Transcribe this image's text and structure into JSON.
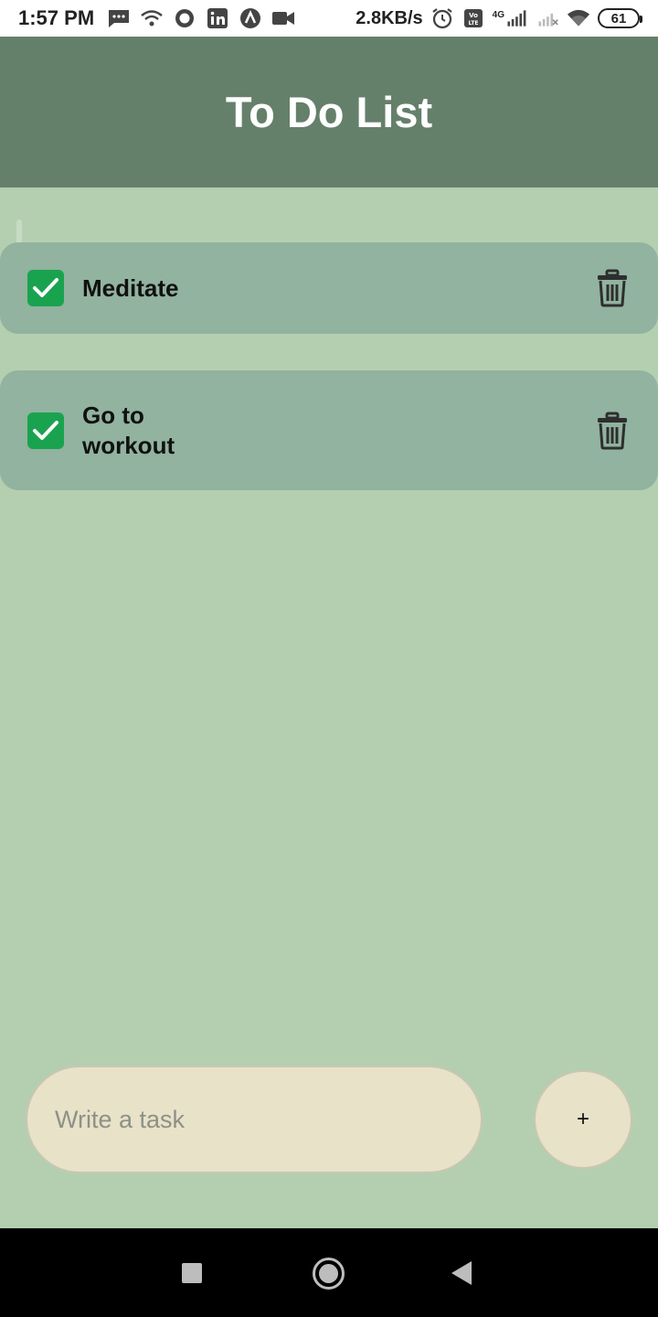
{
  "status_bar": {
    "time": "1:57 PM",
    "speed": "2.8KB/s",
    "network": "4G",
    "battery": "61",
    "icons": [
      "message-icon",
      "wifi-icon",
      "circle-app-icon",
      "linkedin-icon",
      "arrow-app-icon",
      "video-icon",
      "alarm-icon",
      "volte-icon",
      "signal-icon",
      "wifi-icon"
    ]
  },
  "header": {
    "title": "To Do List"
  },
  "tasks": [
    {
      "text": "Meditate",
      "checked": true
    },
    {
      "text": "Go to workout",
      "checked": true
    }
  ],
  "composer": {
    "placeholder": "Write a task",
    "value": "",
    "add_label": "+"
  },
  "colors": {
    "header": "#65806a",
    "background": "#b4cfb0",
    "card": "#91b39f",
    "checkbox": "#1aa34f",
    "input": "#e7e2c8"
  }
}
